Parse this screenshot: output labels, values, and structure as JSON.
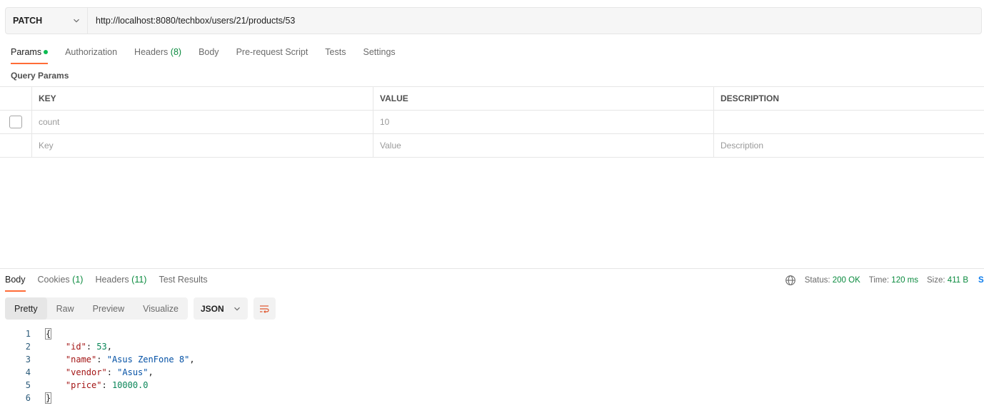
{
  "request": {
    "method": "PATCH",
    "url": "http://localhost:8080/techbox/users/21/products/53"
  },
  "request_tabs": [
    {
      "label": "Params",
      "active": true,
      "dot": true
    },
    {
      "label": "Authorization"
    },
    {
      "label": "Headers",
      "count": "(8)"
    },
    {
      "label": "Body"
    },
    {
      "label": "Pre-request Script"
    },
    {
      "label": "Tests"
    },
    {
      "label": "Settings"
    }
  ],
  "query_params": {
    "title": "Query Params",
    "columns": {
      "key": "KEY",
      "value": "VALUE",
      "description": "DESCRIPTION"
    },
    "rows": [
      {
        "key": "count",
        "value": "10",
        "description": "",
        "checked": false
      }
    ],
    "placeholders": {
      "key": "Key",
      "value": "Value",
      "description": "Description"
    }
  },
  "response_tabs": [
    {
      "label": "Body",
      "active": true
    },
    {
      "label": "Cookies",
      "count": "(1)"
    },
    {
      "label": "Headers",
      "count": "(11)"
    },
    {
      "label": "Test Results"
    }
  ],
  "status": {
    "status_label": "Status:",
    "status_value": "200 OK",
    "time_label": "Time:",
    "time_value": "120 ms",
    "size_label": "Size:",
    "size_value": "411 B",
    "cut_label": "S"
  },
  "view_modes": [
    "Pretty",
    "Raw",
    "Preview",
    "Visualize"
  ],
  "active_view": "Pretty",
  "format": "JSON",
  "code_lines": [
    {
      "n": "1"
    },
    {
      "n": "2",
      "key": "\"id\"",
      "val": "53",
      "type": "num"
    },
    {
      "n": "3",
      "key": "\"name\"",
      "val": "\"Asus ZenFone 8\"",
      "type": "str"
    },
    {
      "n": "4",
      "key": "\"vendor\"",
      "val": "\"Asus\"",
      "type": "str"
    },
    {
      "n": "5",
      "key": "\"price\"",
      "val": "10000.0",
      "type": "num"
    },
    {
      "n": "6"
    }
  ],
  "code_open": "{",
  "code_close": "}",
  "colors": {
    "accent": "#ff6c37",
    "success": "#0a8a3e",
    "string": "#0451a5",
    "key": "#a31515",
    "number": "#098658"
  }
}
